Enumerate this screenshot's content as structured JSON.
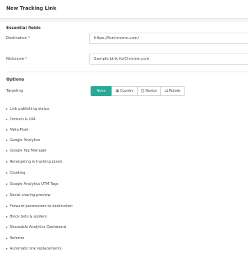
{
  "header": {
    "title": "New Tracking Link"
  },
  "essential": {
    "title": "Essential fields",
    "destination_label": "Destination *",
    "destination_value": "https://forchrome.com/",
    "nickname_label": "Nickname *",
    "nickname_value": "Sample Link forChrome.com"
  },
  "options": {
    "title": "Options",
    "targeting_label": "Targeting",
    "targeting_buttons": [
      {
        "label": "None",
        "icon": "",
        "active": true
      },
      {
        "label": "Country",
        "icon": "globe-icon",
        "active": false
      },
      {
        "label": "Device",
        "icon": "device-icon",
        "active": false
      },
      {
        "label": "Rotate",
        "icon": "shuffle-icon",
        "active": false
      }
    ],
    "sections": [
      "Link publishing status",
      "Domain & URL",
      "Meta Pixel",
      "Google Analytics",
      "Google Tag Manager",
      "Retargeting & tracking pixels",
      "Cloaking",
      "Google Analytics UTM Tags",
      "Social sharing preview",
      "Forward parameters to destination",
      "Block bots & spiders",
      "Shareable Analytics Dashboard",
      "Referrer",
      "Automatic link replacements"
    ]
  },
  "colors": {
    "accent": "#27a996"
  }
}
